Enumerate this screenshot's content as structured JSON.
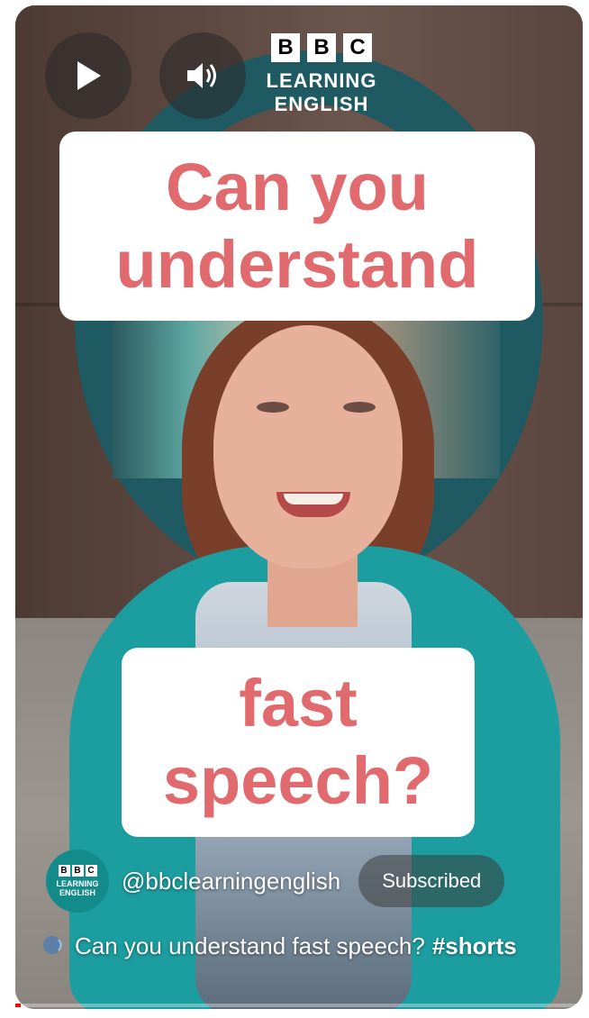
{
  "brand": {
    "boxes": [
      "B",
      "B",
      "C"
    ],
    "line": "LEARNING ENGLISH"
  },
  "overlay": {
    "top_text_line1": "Can you",
    "top_text_line2": "understand",
    "bottom_text_line1": "fast",
    "bottom_text_line2": "speech?"
  },
  "channel": {
    "avatar_boxes": [
      "B",
      "B",
      "C"
    ],
    "avatar_line1": "LEARNING",
    "avatar_line2": "ENGLISH",
    "handle": "@bbclearningenglish",
    "subscribe_label": "Subscribed"
  },
  "video": {
    "title_text": "Can you understand fast speech?",
    "hashtag": "#shorts",
    "progress_fraction": 0.01
  },
  "icons": {
    "play": "play-icon",
    "volume": "volume-icon",
    "speech": "speaking-head-icon"
  },
  "colors": {
    "overlay_text": "#e06a6d",
    "progress": "#ff0000",
    "avatar_bg": "#138b8a"
  }
}
